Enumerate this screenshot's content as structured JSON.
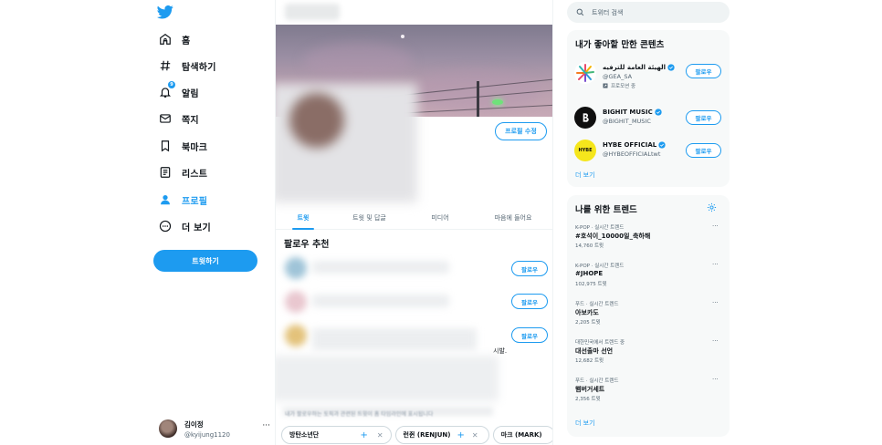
{
  "nav": {
    "items": [
      {
        "label": "홈",
        "icon": "home-icon"
      },
      {
        "label": "탐색하기",
        "icon": "hashtag-icon"
      },
      {
        "label": "알림",
        "icon": "bell-icon",
        "badge": "9"
      },
      {
        "label": "쪽지",
        "icon": "mail-icon"
      },
      {
        "label": "북마크",
        "icon": "bookmark-icon"
      },
      {
        "label": "리스트",
        "icon": "list-icon"
      },
      {
        "label": "프로필",
        "icon": "profile-icon",
        "active": true
      },
      {
        "label": "더 보기",
        "icon": "more-icon"
      }
    ],
    "tweet_button": "트윗하기",
    "account": {
      "name": "김이정",
      "handle": "@kyijung1120",
      "menu": "···"
    }
  },
  "profile": {
    "edit_button": "프로필 수정",
    "tabs": [
      "트윗",
      "트윗 및 답글",
      "미디어",
      "마음에 들어요"
    ],
    "follow_title": "팔로우 추천",
    "follow_button": "팔로우",
    "tail_text": "시발.",
    "bottom_hint": "내가 팔로우하는 토픽과 관련된 트윗이 홈 타임라인에 표시됩니다",
    "topic_chips": [
      {
        "label": "방탄소년단",
        "plus": "+",
        "x": "✕"
      },
      {
        "label": "런쥔 (RENJUN)",
        "plus": "+",
        "x": "✕"
      },
      {
        "label": "마크 (MARK)"
      }
    ]
  },
  "sidebar": {
    "search_placeholder": "트위터 검색",
    "who_title": "내가 좋아할 만한 콘텐츠",
    "who": [
      {
        "name": "الهيئة العامة للترفيه",
        "handle": "@GEA_SA",
        "promo": "프로모션 중",
        "button": "팔로우"
      },
      {
        "name": "BIGHIT MUSIC",
        "handle": "@BIGHIT_MUSIC",
        "button": "팔로우"
      },
      {
        "name": "HYBE OFFICIAL",
        "handle": "@HYBEOFFICIALtwt",
        "button": "팔로우",
        "avatar_text": "HYBE"
      }
    ],
    "who_more": "더 보기",
    "trends_title": "나를 위한 트렌드",
    "trends": [
      {
        "context": "K-POP · 실시간 트렌드",
        "name": "#호석이_10000일_축하해",
        "count": "14,760 트윗"
      },
      {
        "context": "K-POP · 실시간 트렌드",
        "name": "#JHOPE",
        "count": "102,975 트윗"
      },
      {
        "context": "푸드 · 실시간 트렌드",
        "name": "아보카도",
        "count": "2,205 트윗"
      },
      {
        "context": "대한민국에서 트렌드 중",
        "name": "대선출마 선언",
        "count": "12,682 트윗"
      },
      {
        "context": "푸드 · 실시간 트렌드",
        "name": "햄버거세트",
        "count": "2,356 트윗"
      }
    ],
    "trends_more": "더 보기",
    "trend_menu": "···"
  },
  "colors": {
    "accent": "#1d9bf0",
    "text": "#0f1419",
    "muted": "#536471",
    "card_bg": "#f7f9f9"
  }
}
